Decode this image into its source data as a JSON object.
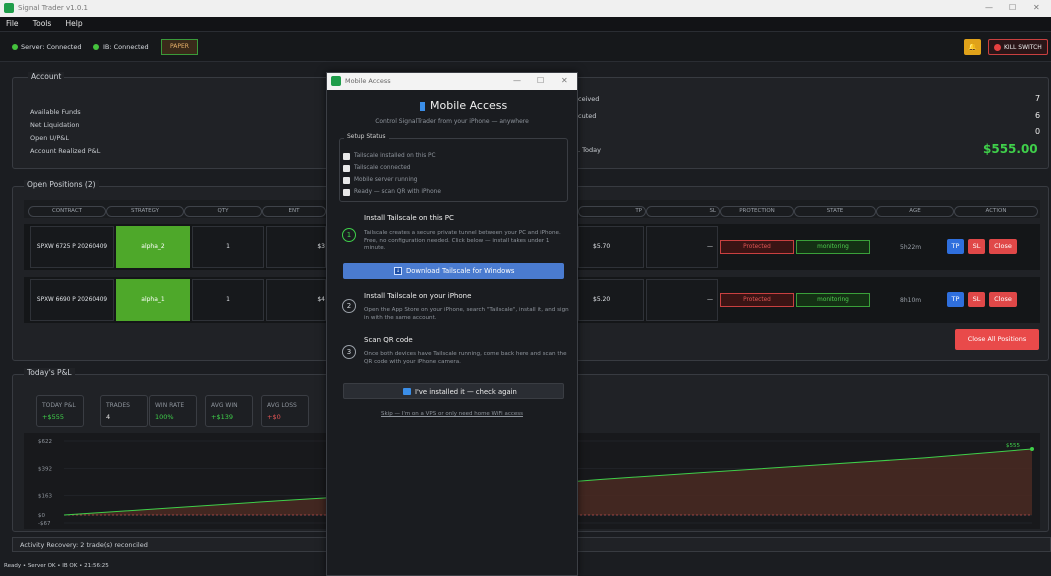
{
  "window": {
    "title": "Signal Trader v1.0.1",
    "min": "—",
    "max": "☐",
    "close": "✕"
  },
  "menu": [
    "File",
    "Tools",
    "Help"
  ],
  "status": {
    "server": "Server: Connected",
    "ib": "IB: Connected",
    "mode": "PAPER",
    "bell": "🔔",
    "kill": "KILL SWITCH"
  },
  "account": {
    "label": "Account",
    "rows": [
      "Available Funds",
      "Net Liquidation",
      "Open U/P&L",
      "Account Realized P&L"
    ],
    "right_rows": [
      "ceived",
      "cuted",
      ". Today"
    ],
    "right_values": [
      "7",
      "6",
      "0",
      "$555.00"
    ]
  },
  "positions": {
    "label": "Open Positions (2)",
    "headers": [
      "CONTRACT",
      "STRATEGY",
      "QTY",
      "ENT",
      "TP",
      "SL",
      "PROTECTION",
      "STATE",
      "AGE",
      "ACTION"
    ],
    "rows": [
      {
        "contract": "SPXW 6725 P 20260409",
        "strategy": "alpha_2",
        "qty": "1",
        "ent": "$3",
        "tp": "$5.70",
        "sl": "—",
        "protection": "Protected",
        "state": "monitoring",
        "age": "5h22m"
      },
      {
        "contract": "SPXW 6690 P 20260409",
        "strategy": "alpha_1",
        "qty": "1",
        "ent": "$4",
        "tp": "$5.20",
        "sl": "—",
        "protection": "Protected",
        "state": "monitoring",
        "age": "8h10m"
      }
    ],
    "tp": "TP",
    "sl": "SL",
    "close": "Close",
    "close_all": "Close All Positions"
  },
  "pnl": {
    "label": "Today's P&L",
    "stats": [
      {
        "label": "TODAY P&L",
        "value": "+$555"
      },
      {
        "label": "TRADES",
        "value": "4"
      },
      {
        "label": "WIN RATE",
        "value": "100%"
      },
      {
        "label": "AVG WIN",
        "value": "+$139"
      },
      {
        "label": "AVG LOSS",
        "value": "+$0"
      }
    ]
  },
  "chart_data": {
    "type": "area",
    "yticks": [
      "$622",
      "$392",
      "$163",
      "$0",
      "-$67"
    ],
    "end_label": "$555",
    "x": [
      0,
      1,
      2,
      3,
      4,
      5,
      6,
      7,
      8,
      9
    ],
    "values": [
      0,
      60,
      120,
      175,
      230,
      300,
      360,
      420,
      480,
      555
    ],
    "ylim": [
      -67,
      622
    ]
  },
  "activity": {
    "text": "Activity   Recovery: 2 trade(s) reconciled"
  },
  "footer": "Ready • Server OK • IB OK • 21:56:25",
  "modal": {
    "title": "Mobile Access",
    "heading": "Mobile Access",
    "subtitle": "Control SignalTrader from your iPhone — anywhere",
    "setup_label": "Setup Status",
    "checks": [
      "Tailscale installed on this PC",
      "Tailscale connected",
      "Mobile server running",
      "Ready — scan QR with iPhone"
    ],
    "step1_title": "Install Tailscale on this PC",
    "step1_text": "Tailscale creates a secure private tunnel between your PC and iPhone. Free, no configuration needed. Click below — install takes under 1 minute.",
    "download": "Download Tailscale for Windows",
    "step2_title": "Install Tailscale on your iPhone",
    "step2_text": "Open the App Store on your iPhone, search \"Tailscale\", install it, and sign in with the same account.",
    "step3_title": "Scan QR code",
    "step3_text": "Once both devices have Tailscale running, come back here and scan the QR code with your iPhone camera.",
    "check_again": "I've installed it — check again",
    "skip": "Skip — I'm on a VPS or only need home WiFi access",
    "n1": "1",
    "n2": "2",
    "n3": "3"
  },
  "colors": {
    "green": "#3fae3a",
    "red": "#e04848",
    "blue": "#2f6fdd",
    "accent": "#4a7bd0"
  }
}
